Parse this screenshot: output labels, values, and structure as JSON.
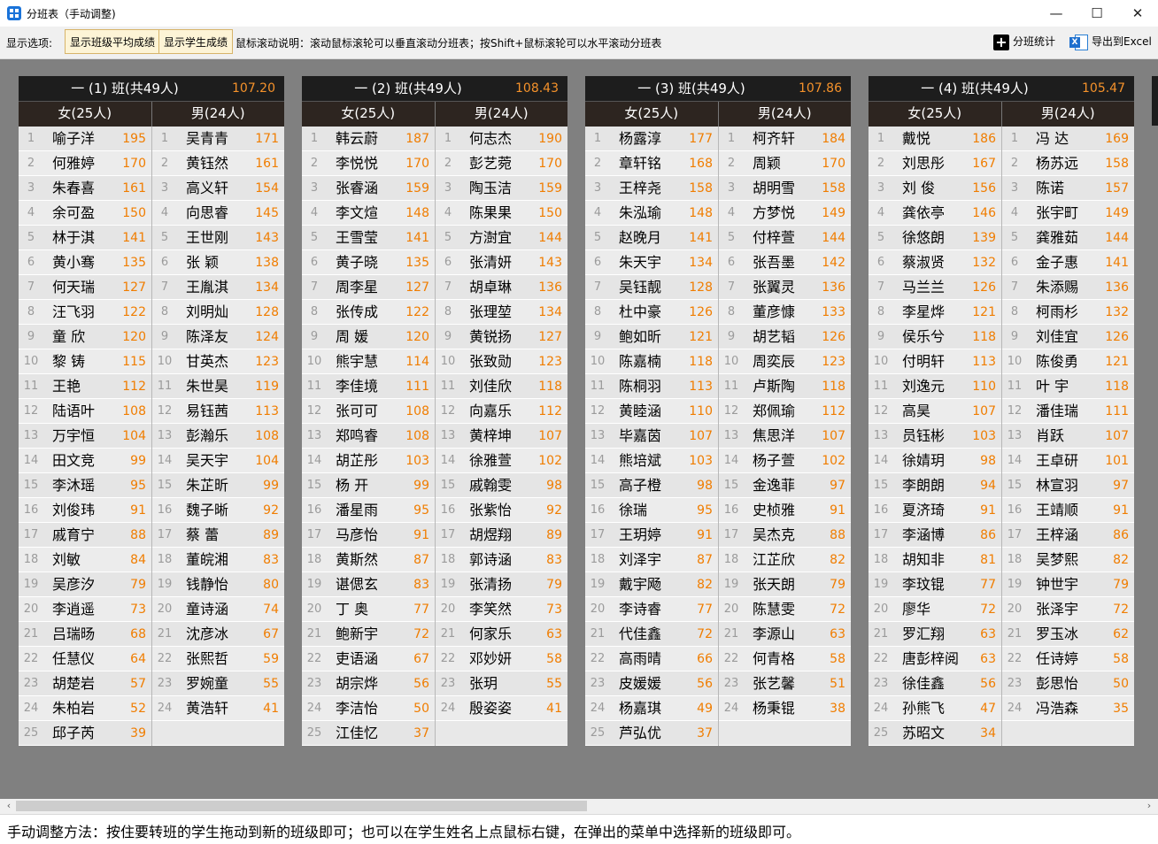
{
  "window": {
    "title": "分班表（手动调整)",
    "minimize": "—",
    "maximize": "☐",
    "close": "✕"
  },
  "toolbar": {
    "options_label": "显示选项:",
    "toggle_avg": "显示班级平均成绩",
    "toggle_scores": "显示学生成绩",
    "scroll_hint": "鼠标滚动说明：滚动鼠标滚轮可以垂直滚动分班表；按Shift+鼠标滚轮可以水平滚动分班表",
    "stats_label": "分班统计",
    "export_label": "导出到Excel",
    "excel_glyph": "X"
  },
  "icons": {
    "stats": "plus-icon",
    "export": "excel-export-icon"
  },
  "colors": {
    "score": "#f07d00",
    "header_bg": "#1d1d1d",
    "toggle_bg": "#fdf4d6"
  },
  "classes": [
    {
      "title": "一 (1) 班(共49人)",
      "avg": "107.20",
      "female_header": "女(25人)",
      "male_header": "男(24人)",
      "female": [
        [
          "1",
          "喻子洋",
          "195"
        ],
        [
          "2",
          "何雅婷",
          "170"
        ],
        [
          "3",
          "朱春喜",
          "161"
        ],
        [
          "4",
          "余可盈",
          "150"
        ],
        [
          "5",
          "林于淇",
          "141"
        ],
        [
          "6",
          "黄小骞",
          "135"
        ],
        [
          "7",
          "何天瑞",
          "127"
        ],
        [
          "8",
          "汪飞羽",
          "122"
        ],
        [
          "9",
          "童 欣",
          "120"
        ],
        [
          "10",
          "黎 铸",
          "115"
        ],
        [
          "11",
          "王艳",
          "112"
        ],
        [
          "12",
          "陆语叶",
          "108"
        ],
        [
          "13",
          "万宇恒",
          "104"
        ],
        [
          "14",
          "田文竞",
          "99"
        ],
        [
          "15",
          "李沐瑶",
          "95"
        ],
        [
          "16",
          "刘俊玮",
          "91"
        ],
        [
          "17",
          "戚育宁",
          "88"
        ],
        [
          "18",
          "刘敏",
          "84"
        ],
        [
          "19",
          "吴彦汐",
          "79"
        ],
        [
          "20",
          "李逍遥",
          "73"
        ],
        [
          "21",
          "吕瑞旸",
          "68"
        ],
        [
          "22",
          "任慧仪",
          "64"
        ],
        [
          "23",
          "胡楚岩",
          "57"
        ],
        [
          "24",
          "朱柏岩",
          "52"
        ],
        [
          "25",
          "邱子芮",
          "39"
        ]
      ],
      "male": [
        [
          "1",
          "吴青青",
          "171"
        ],
        [
          "2",
          "黄钰然",
          "161"
        ],
        [
          "3",
          "高义轩",
          "154"
        ],
        [
          "4",
          "向思睿",
          "145"
        ],
        [
          "5",
          "王世刚",
          "143"
        ],
        [
          "6",
          "张 颖",
          "138"
        ],
        [
          "7",
          "王胤淇",
          "134"
        ],
        [
          "8",
          "刘明灿",
          "128"
        ],
        [
          "9",
          "陈泽友",
          "124"
        ],
        [
          "10",
          "甘英杰",
          "123"
        ],
        [
          "11",
          "朱世昊",
          "119"
        ],
        [
          "12",
          "易钰茜",
          "113"
        ],
        [
          "13",
          "彭瀚乐",
          "108"
        ],
        [
          "14",
          "吴天宇",
          "104"
        ],
        [
          "15",
          "朱芷昕",
          "99"
        ],
        [
          "16",
          "魏子晰",
          "92"
        ],
        [
          "17",
          "蔡 蕾",
          "89"
        ],
        [
          "18",
          "董皖湘",
          "83"
        ],
        [
          "19",
          "钱静怡",
          "80"
        ],
        [
          "20",
          "童诗涵",
          "74"
        ],
        [
          "21",
          "沈彦冰",
          "67"
        ],
        [
          "22",
          "张熙哲",
          "59"
        ],
        [
          "23",
          "罗婉童",
          "55"
        ],
        [
          "24",
          "黄浩轩",
          "41"
        ]
      ]
    },
    {
      "title": "一 (2) 班(共49人)",
      "avg": "108.43",
      "female_header": "女(25人)",
      "male_header": "男(24人)",
      "female": [
        [
          "1",
          "韩云蔚",
          "187"
        ],
        [
          "2",
          "李悦悦",
          "170"
        ],
        [
          "3",
          "张睿涵",
          "159"
        ],
        [
          "4",
          "李文煊",
          "148"
        ],
        [
          "5",
          "王雪莹",
          "141"
        ],
        [
          "6",
          "黄子晓",
          "135"
        ],
        [
          "7",
          "周李星",
          "127"
        ],
        [
          "8",
          "张传成",
          "122"
        ],
        [
          "9",
          "周 媛",
          "120"
        ],
        [
          "10",
          "熊宇慧",
          "114"
        ],
        [
          "11",
          "李佳境",
          "111"
        ],
        [
          "12",
          "张可可",
          "108"
        ],
        [
          "13",
          "郑鸣睿",
          "108"
        ],
        [
          "14",
          "胡芷彤",
          "103"
        ],
        [
          "15",
          "杨 开",
          "99"
        ],
        [
          "16",
          "潘星雨",
          "95"
        ],
        [
          "17",
          "马彦怡",
          "91"
        ],
        [
          "18",
          "黄斯然",
          "87"
        ],
        [
          "19",
          "谌偲玄",
          "83"
        ],
        [
          "20",
          "丁 奥",
          "77"
        ],
        [
          "21",
          "鲍新宇",
          "72"
        ],
        [
          "22",
          "吏语涵",
          "67"
        ],
        [
          "23",
          "胡宗烨",
          "56"
        ],
        [
          "24",
          "李洁怡",
          "50"
        ],
        [
          "25",
          "江佳忆",
          "37"
        ]
      ],
      "male": [
        [
          "1",
          "何志杰",
          "190"
        ],
        [
          "2",
          "彭艺菀",
          "170"
        ],
        [
          "3",
          "陶玉洁",
          "159"
        ],
        [
          "4",
          "陈果果",
          "150"
        ],
        [
          "5",
          "方澍宜",
          "144"
        ],
        [
          "6",
          "张清妍",
          "143"
        ],
        [
          "7",
          "胡卓琳",
          "136"
        ],
        [
          "8",
          "张理堃",
          "134"
        ],
        [
          "9",
          "黄锐扬",
          "127"
        ],
        [
          "10",
          "张致勋",
          "123"
        ],
        [
          "11",
          "刘佳欣",
          "118"
        ],
        [
          "12",
          "向嘉乐",
          "112"
        ],
        [
          "13",
          "黄梓坤",
          "107"
        ],
        [
          "14",
          "徐雅萱",
          "102"
        ],
        [
          "15",
          "戚翰雯",
          "98"
        ],
        [
          "16",
          "张紫怡",
          "92"
        ],
        [
          "17",
          "胡煜翔",
          "89"
        ],
        [
          "18",
          "郭诗涵",
          "83"
        ],
        [
          "19",
          "张清扬",
          "79"
        ],
        [
          "20",
          "李笑然",
          "73"
        ],
        [
          "21",
          "何家乐",
          "63"
        ],
        [
          "22",
          "邓妙妍",
          "58"
        ],
        [
          "23",
          "张玥",
          "55"
        ],
        [
          "24",
          "殷姿姿",
          "41"
        ]
      ]
    },
    {
      "title": "一 (3) 班(共49人)",
      "avg": "107.86",
      "female_header": "女(25人)",
      "male_header": "男(24人)",
      "female": [
        [
          "1",
          "杨露淳",
          "177"
        ],
        [
          "2",
          "章轩铭",
          "168"
        ],
        [
          "3",
          "王梓尧",
          "158"
        ],
        [
          "4",
          "朱泓瑜",
          "148"
        ],
        [
          "5",
          "赵晚月",
          "141"
        ],
        [
          "6",
          "朱天宇",
          "134"
        ],
        [
          "7",
          "吴钰靓",
          "128"
        ],
        [
          "8",
          "杜中豪",
          "126"
        ],
        [
          "9",
          "鲍如昕",
          "121"
        ],
        [
          "10",
          "陈嘉楠",
          "118"
        ],
        [
          "11",
          "陈桐羽",
          "113"
        ],
        [
          "12",
          "黄睦涵",
          "110"
        ],
        [
          "13",
          "毕嘉茵",
          "107"
        ],
        [
          "14",
          "熊培斌",
          "103"
        ],
        [
          "15",
          "高子橙",
          "98"
        ],
        [
          "16",
          "徐瑞",
          "95"
        ],
        [
          "17",
          "王玥婷",
          "91"
        ],
        [
          "18",
          "刘泽宇",
          "87"
        ],
        [
          "19",
          "戴宇飏",
          "82"
        ],
        [
          "20",
          "李诗睿",
          "77"
        ],
        [
          "21",
          "代佳鑫",
          "72"
        ],
        [
          "22",
          "高雨晴",
          "66"
        ],
        [
          "23",
          "皮媛媛",
          "56"
        ],
        [
          "24",
          "杨嘉琪",
          "49"
        ],
        [
          "25",
          "芦弘优",
          "37"
        ]
      ],
      "male": [
        [
          "1",
          "柯齐轩",
          "184"
        ],
        [
          "2",
          "周颖",
          "170"
        ],
        [
          "3",
          "胡明雪",
          "158"
        ],
        [
          "4",
          "方梦悦",
          "149"
        ],
        [
          "5",
          "付梓萱",
          "144"
        ],
        [
          "6",
          "张吾墨",
          "142"
        ],
        [
          "7",
          "张翼灵",
          "136"
        ],
        [
          "8",
          "董彦慷",
          "133"
        ],
        [
          "9",
          "胡艺韬",
          "126"
        ],
        [
          "10",
          "周奕辰",
          "123"
        ],
        [
          "11",
          "卢斯陶",
          "118"
        ],
        [
          "12",
          "郑佩瑜",
          "112"
        ],
        [
          "13",
          "焦思洋",
          "107"
        ],
        [
          "14",
          "杨子萱",
          "102"
        ],
        [
          "15",
          "金逸菲",
          "97"
        ],
        [
          "16",
          "史桢雅",
          "91"
        ],
        [
          "17",
          "吴杰克",
          "88"
        ],
        [
          "18",
          "江芷欣",
          "82"
        ],
        [
          "19",
          "张天朗",
          "79"
        ],
        [
          "20",
          "陈慧雯",
          "72"
        ],
        [
          "21",
          "李源山",
          "63"
        ],
        [
          "22",
          "何青格",
          "58"
        ],
        [
          "23",
          "张艺馨",
          "51"
        ],
        [
          "24",
          "杨秉锟",
          "38"
        ]
      ]
    },
    {
      "title": "一 (4) 班(共49人)",
      "avg": "105.47",
      "female_header": "女(25人)",
      "male_header": "男(24人)",
      "female": [
        [
          "1",
          "戴悦",
          "186"
        ],
        [
          "2",
          "刘思彤",
          "167"
        ],
        [
          "3",
          "刘 俊",
          "156"
        ],
        [
          "4",
          "龚依亭",
          "146"
        ],
        [
          "5",
          "徐悠朗",
          "139"
        ],
        [
          "6",
          "蔡淑贤",
          "132"
        ],
        [
          "7",
          "马兰兰",
          "126"
        ],
        [
          "8",
          "李星烨",
          "121"
        ],
        [
          "9",
          "侯乐兮",
          "118"
        ],
        [
          "10",
          "付明轩",
          "113"
        ],
        [
          "11",
          "刘逸元",
          "110"
        ],
        [
          "12",
          "高昊",
          "107"
        ],
        [
          "13",
          "员钰彬",
          "103"
        ],
        [
          "14",
          "徐婧玥",
          "98"
        ],
        [
          "15",
          "李朗朗",
          "94"
        ],
        [
          "16",
          "夏济琦",
          "91"
        ],
        [
          "17",
          "李涵博",
          "86"
        ],
        [
          "18",
          "胡知非",
          "81"
        ],
        [
          "19",
          "李玟锟",
          "77"
        ],
        [
          "20",
          "廖华",
          "72"
        ],
        [
          "21",
          "罗汇翔",
          "63"
        ],
        [
          "22",
          "唐彭梓阅",
          "63"
        ],
        [
          "23",
          "徐佳鑫",
          "56"
        ],
        [
          "24",
          "孙熊飞",
          "47"
        ],
        [
          "25",
          "苏昭文",
          "34"
        ]
      ],
      "male": [
        [
          "1",
          "冯 达",
          "169"
        ],
        [
          "2",
          "杨苏远",
          "158"
        ],
        [
          "3",
          "陈诺",
          "157"
        ],
        [
          "4",
          "张宇町",
          "149"
        ],
        [
          "5",
          "龚雅茹",
          "144"
        ],
        [
          "6",
          "金子惠",
          "141"
        ],
        [
          "7",
          "朱添赐",
          "136"
        ],
        [
          "8",
          "柯雨杉",
          "132"
        ],
        [
          "9",
          "刘佳宜",
          "126"
        ],
        [
          "10",
          "陈俊勇",
          "121"
        ],
        [
          "11",
          "叶 宇",
          "118"
        ],
        [
          "12",
          "潘佳瑞",
          "111"
        ],
        [
          "13",
          "肖跃",
          "107"
        ],
        [
          "14",
          "王卓研",
          "101"
        ],
        [
          "15",
          "林宣羽",
          "97"
        ],
        [
          "16",
          "王靖顺",
          "91"
        ],
        [
          "17",
          "王梓涵",
          "86"
        ],
        [
          "18",
          "吴梦熙",
          "82"
        ],
        [
          "19",
          "钟世宇",
          "79"
        ],
        [
          "20",
          "张泽宇",
          "72"
        ],
        [
          "21",
          "罗玉冰",
          "62"
        ],
        [
          "22",
          "任诗婷",
          "58"
        ],
        [
          "23",
          "彭思怡",
          "50"
        ],
        [
          "24",
          "冯浩森",
          "35"
        ]
      ]
    }
  ],
  "scrollbar": {
    "left": "‹",
    "right": "›"
  },
  "status": "手动调整方法：按住要转班的学生拖动到新的班级即可；也可以在学生姓名上点鼠标右键，在弹出的菜单中选择新的班级即可。"
}
